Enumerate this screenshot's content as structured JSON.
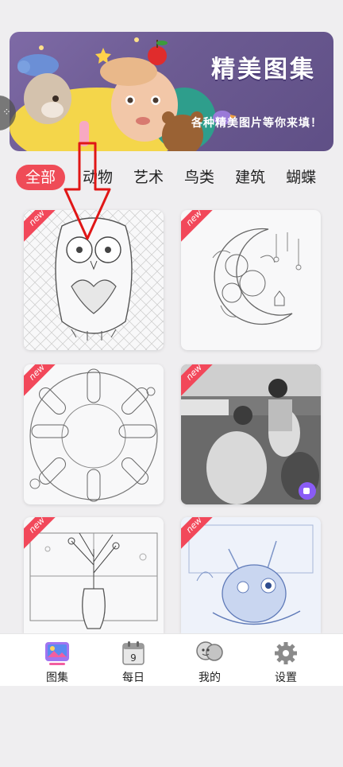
{
  "banner": {
    "title": "精美图集",
    "subtitle": "各种精美图片等你来填！"
  },
  "tabs": [
    {
      "label": "全部",
      "active": true
    },
    {
      "label": "动物",
      "active": false
    },
    {
      "label": "艺术",
      "active": false
    },
    {
      "label": "鸟类",
      "active": false
    },
    {
      "label": "建筑",
      "active": false
    },
    {
      "label": "蝴蝶",
      "active": false
    }
  ],
  "cards": [
    {
      "name": "owl",
      "badge": "new"
    },
    {
      "name": "moon-flowers",
      "badge": "new"
    },
    {
      "name": "ice-cream-plate",
      "badge": "new"
    },
    {
      "name": "photo-women",
      "badge": "new",
      "has_video": true
    },
    {
      "name": "vase-window",
      "badge": "new"
    },
    {
      "name": "cat-blue",
      "badge": "new"
    }
  ],
  "calendar_day": "9",
  "nav": [
    {
      "label": "图集",
      "icon": "gallery-icon",
      "active": true
    },
    {
      "label": "每日",
      "icon": "calendar-icon",
      "active": false
    },
    {
      "label": "我的",
      "icon": "profile-icon",
      "active": false
    },
    {
      "label": "设置",
      "icon": "gear-icon",
      "active": false
    }
  ],
  "colors": {
    "accent": "#ef4b57",
    "badge": "#f2485a",
    "banner_bg": "#6c5b92",
    "annotation_arrow": "#e01616"
  }
}
